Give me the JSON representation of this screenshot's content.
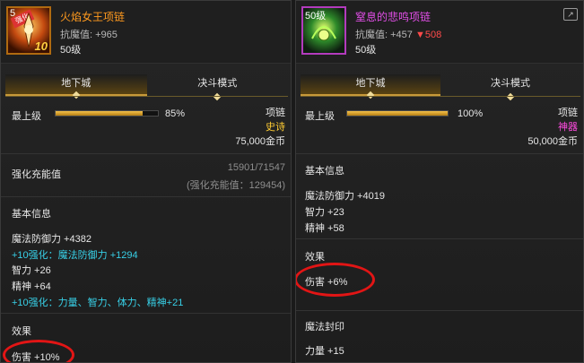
{
  "left": {
    "icon": {
      "level": "5",
      "badge": "10"
    },
    "title": "火焰女王项链",
    "resist_label": "抗魔值",
    "resist_value": ": +965",
    "level": "50级",
    "tabs": [
      "地下城",
      "决斗模式"
    ],
    "max_level_label": "最上级",
    "progress": {
      "value": 0.85,
      "text": "85%"
    },
    "slot": "项链",
    "rarity": "史诗",
    "price": "75,000金币",
    "enhance_label": "强化充能值",
    "enhance_value": "15901/71547",
    "enhance_sub": "(强化充能值：129454)",
    "basic_info_header": "基本信息",
    "stats": [
      {
        "text": "魔法防御力 +4382",
        "style": "normal"
      },
      {
        "text": "+10强化：魔法防御力 +1294",
        "style": "cyan"
      },
      {
        "text": "智力 +26",
        "style": "normal"
      },
      {
        "text": "精神 +64",
        "style": "normal"
      },
      {
        "text": "+10强化：力量、智力、体力、精神+21",
        "style": "cyan"
      }
    ],
    "effect_header": "效果",
    "effect": "伤害 +10%"
  },
  "right": {
    "icon": {
      "level": "50级"
    },
    "title": "窒息的悲鸣项链",
    "resist_label": "抗魔值",
    "resist_value": ": +457",
    "resist_down": "▼508",
    "level": "50级",
    "tabs": [
      "地下城",
      "决斗模式"
    ],
    "max_level_label": "最上级",
    "progress": {
      "value": 1.0,
      "text": "100%"
    },
    "slot": "项链",
    "rarity": "神器",
    "price": "50,000金币",
    "basic_info_header": "基本信息",
    "stats": [
      {
        "text": "魔法防御力 +4019",
        "style": "normal"
      },
      {
        "text": "智力 +23",
        "style": "normal"
      },
      {
        "text": "精神 +58",
        "style": "normal"
      }
    ],
    "effect_header": "效果",
    "effect": "伤害 +6%",
    "seal_header": "魔法封印",
    "seal_stat": "力量 +15",
    "share_icon": "share-icon"
  },
  "colors": {
    "epic": "#ffcc33",
    "artifact": "#ff4be0",
    "enhance": "#37cfe6",
    "decrease": "#ff4b4b",
    "highlight_circle": "#e21515"
  }
}
